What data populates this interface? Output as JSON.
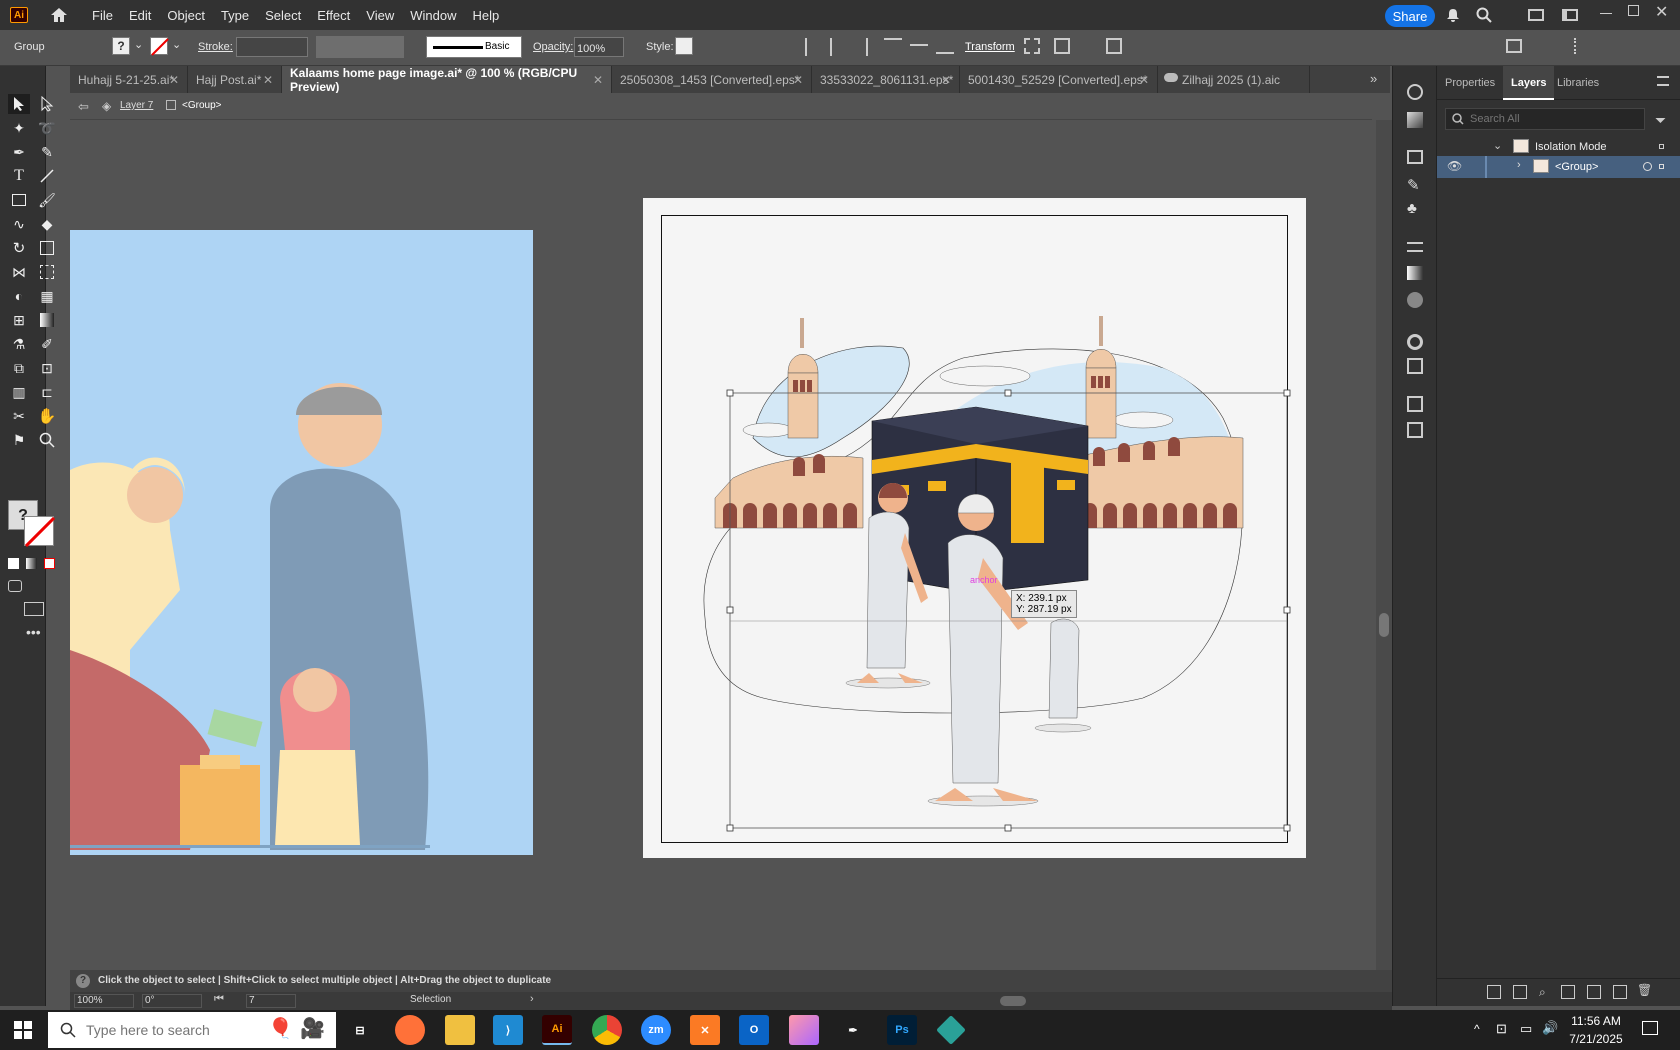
{
  "menubar": {
    "items": [
      "File",
      "Edit",
      "Object",
      "Type",
      "Select",
      "Effect",
      "View",
      "Window",
      "Help"
    ],
    "share_label": "Share",
    "logo_text": "Ai"
  },
  "control_bar": {
    "selection_type": "Group",
    "stroke_label": "Stroke:",
    "brush_label": "Basic",
    "opacity_label": "Opacity:",
    "opacity_value": "100%",
    "style_label": "Style:",
    "transform_label": "Transform"
  },
  "tabs": [
    {
      "label": "Huhajj 5-21-25.ai*",
      "active": false
    },
    {
      "label": "Hajj Post.ai*",
      "active": false
    },
    {
      "label": "Kalaams home page image.ai* @ 100 % (RGB/CPU Preview)",
      "active": true
    },
    {
      "label": "25050308_1453 [Converted].eps*",
      "active": false
    },
    {
      "label": "33533022_8061131.eps*",
      "active": false
    },
    {
      "label": "5001430_52529 [Converted].eps*",
      "active": false
    },
    {
      "label": "Zilhajj 2025 (1).aic",
      "active": false
    }
  ],
  "breadcrumb": {
    "layer": "Layer 7",
    "group": "<Group>"
  },
  "canvas": {
    "tooltip_x": "X: 239.1 px",
    "tooltip_y": "Y: 287.19 px",
    "smart_guide": "anchor"
  },
  "right_panel": {
    "tabs": [
      "Properties",
      "Layers",
      "Libraries"
    ],
    "active_tab": "Layers",
    "search_placeholder": "Search All",
    "layers": [
      {
        "name": "Isolation Mode"
      },
      {
        "name": "<Group>"
      }
    ]
  },
  "status": {
    "hint": "Click the object to select  |  Shift+Click to select multiple object  |  Alt+Drag the object to duplicate",
    "zoom": "100%",
    "rotation": "0°",
    "artboard": "7",
    "tool": "Selection"
  },
  "taskbar": {
    "search_placeholder": "Type here to search",
    "time": "11:56 AM",
    "date": "7/21/2025",
    "apps": [
      "Ai",
      "zm",
      "Ps"
    ]
  },
  "colors": {
    "accent": "#1473e6",
    "sky": "#aed4f4",
    "kaaba": "#2d3042",
    "kaaba_gold": "#f2b31c",
    "arches": "#8f4a3e"
  }
}
